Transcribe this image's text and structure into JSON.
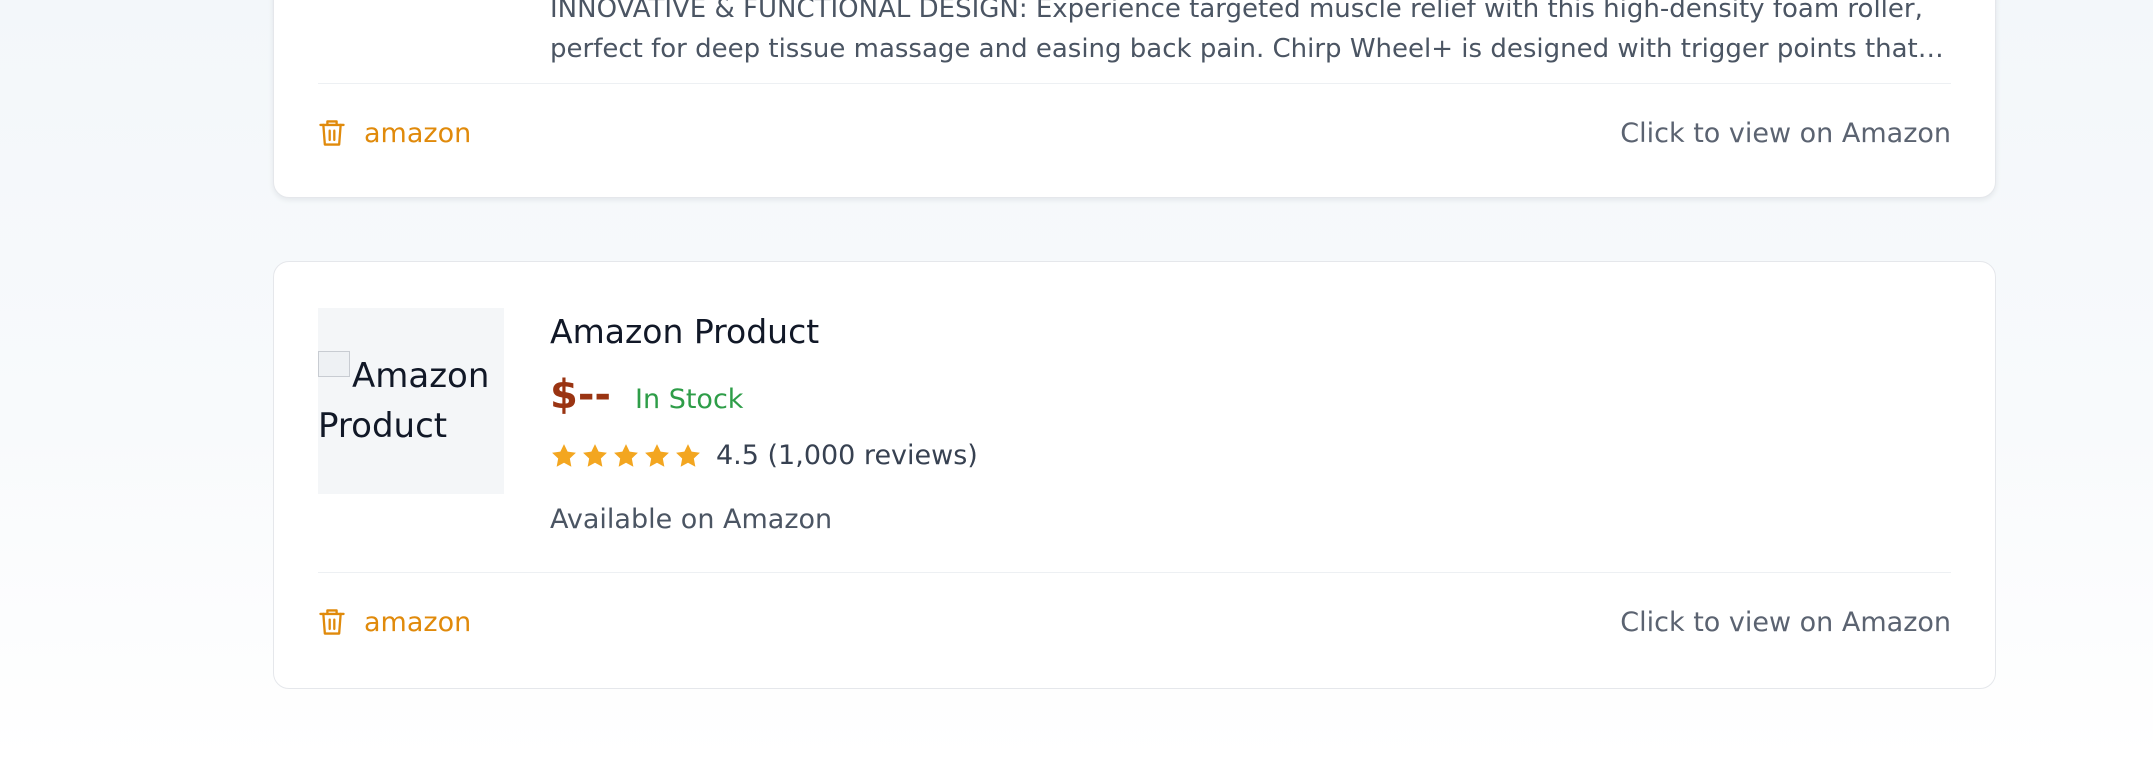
{
  "cards": [
    {
      "description_lines": [
        "INNOVATIVE & FUNCTIONAL DESIGN: Experience targeted muscle relief with this high-density foam roller,",
        "perfect for deep tissue massage and easing back pain. Chirp Wheel+ is designed with trigger points that…"
      ],
      "source_label": "amazon",
      "view_link": "Click to view on Amazon"
    },
    {
      "image_alt_line1": "Amazon",
      "image_alt_line2": "Product",
      "title": "Amazon Product",
      "price": "$--",
      "stock": "In Stock",
      "rating": 4.5,
      "rating_text": "4.5 (1,000 reviews)",
      "availability": "Available on Amazon",
      "source_label": "amazon",
      "view_link": "Click to view on Amazon"
    }
  ],
  "colors": {
    "accent_orange": "#e08a0b",
    "price_red": "#9a3412",
    "stock_green": "#2e9d48",
    "star_gold": "#f3a620"
  },
  "icons": {
    "source": "trash-icon",
    "rating": "star-icon"
  }
}
